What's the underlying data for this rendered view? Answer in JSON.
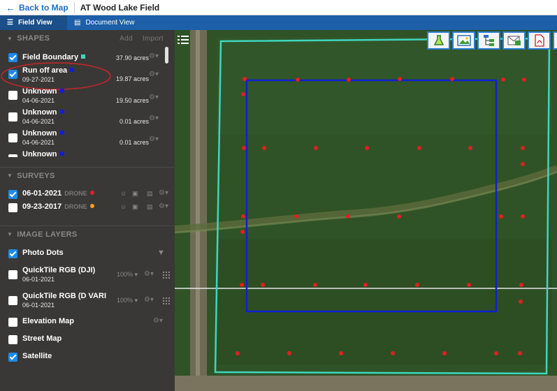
{
  "topbar": {
    "back_label": "Back to Map",
    "field_title": "AT Wood Lake Field"
  },
  "tabs": [
    {
      "label": "Field View",
      "icon": "layers-icon"
    },
    {
      "label": "Document View",
      "icon": "document-icon"
    }
  ],
  "shapes": {
    "header": "SHAPES",
    "add_label": "Add",
    "import_label": "Import",
    "items": [
      {
        "name": "Field Boundary",
        "date": "",
        "acres": "37.90 acres",
        "checked": true,
        "color": "#3fd6c0"
      },
      {
        "name": "Run off area",
        "date": "09-27-2021",
        "acres": "19.87 acres",
        "checked": true,
        "color": "#1020d0"
      },
      {
        "name": "Unknown",
        "date": "04-06-2021",
        "acres": "19.50 acres",
        "checked": false,
        "color": "#1020d0"
      },
      {
        "name": "Unknown",
        "date": "04-06-2021",
        "acres": "0.01 acres",
        "checked": false,
        "color": "#1020d0"
      },
      {
        "name": "Unknown",
        "date": "04-06-2021",
        "acres": "0.01 acres",
        "checked": false,
        "color": "#1020d0"
      },
      {
        "name": "Unknown",
        "date": "",
        "acres": "",
        "checked": false,
        "color": "#1020d0"
      }
    ]
  },
  "surveys": {
    "header": "SURVEYS",
    "items": [
      {
        "date": "06-01-2021",
        "source": "DRONE",
        "checked": true,
        "color": "#e02020"
      },
      {
        "date": "09-23-2017",
        "source": "DRONE",
        "checked": false,
        "color": "#f0a020"
      }
    ]
  },
  "image_layers": {
    "header": "IMAGE LAYERS",
    "items": [
      {
        "name": "Photo Dots",
        "date": "",
        "opacity": "",
        "checked": true
      },
      {
        "name": "QuickTile RGB (DJI)",
        "date": "06-01-2021",
        "opacity": "100%",
        "checked": false
      },
      {
        "name": "QuickTile RGB (D VARI",
        "date": "06-01-2021",
        "opacity": "100%",
        "checked": false
      },
      {
        "name": "Elevation Map",
        "date": "",
        "opacity": "",
        "checked": false
      },
      {
        "name": "Street Map",
        "date": "",
        "opacity": "",
        "checked": false
      },
      {
        "name": "Satellite",
        "date": "",
        "opacity": "",
        "checked": true
      }
    ]
  },
  "map": {
    "toolbar": [
      "flask-icon",
      "image-icon",
      "hierarchy-icon",
      "mail-image-icon",
      "pdf-icon"
    ],
    "boundary_color": "#3fd6c0",
    "runoff_color": "#1020d0",
    "survey_point_color": "#e02020"
  }
}
